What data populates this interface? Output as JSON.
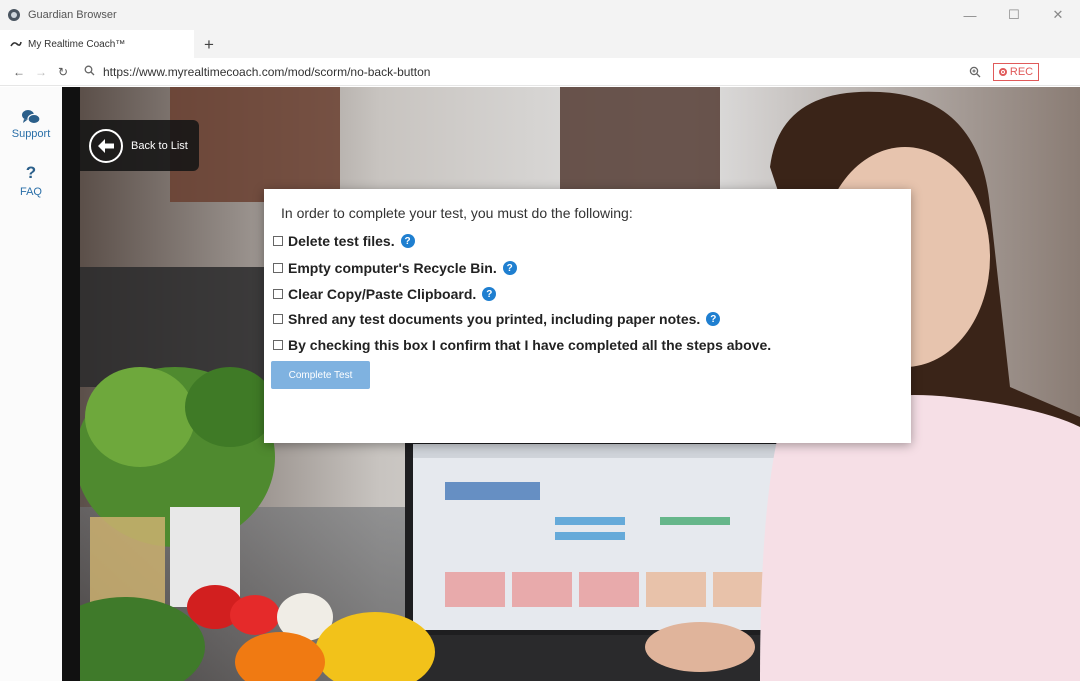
{
  "window": {
    "title": "Guardian Browser"
  },
  "tab": {
    "label": "My Realtime Coach™"
  },
  "address": {
    "url": "https://www.myrealtimecoach.com/mod/scorm/no-back-button"
  },
  "toolbar": {
    "rec_label": "REC"
  },
  "sidebar": {
    "support_label": "Support",
    "faq_glyph": "?",
    "faq_label": "FAQ"
  },
  "back": {
    "label": "Back to List"
  },
  "dialog": {
    "intro": "In order to complete your test, you must do the following:",
    "items": [
      {
        "label": "Delete test files.",
        "help": true
      },
      {
        "label": "Empty computer's Recycle Bin.",
        "help": true
      },
      {
        "label": "Clear Copy/Paste Clipboard.",
        "help": true
      },
      {
        "label": "Shred any test documents you printed, including paper notes.",
        "help": true
      },
      {
        "label": "By checking this box I confirm that I have completed all the steps above.",
        "help": false
      }
    ],
    "help_glyph": "?",
    "button_label": "Complete Test"
  },
  "colors": {
    "accent": "#1f7fd0",
    "button": "#7fb2e0",
    "rec": "#e05a5a",
    "sidebar_text": "#2a6fa8"
  },
  "icons": {
    "app": "shield-icon",
    "support": "chat-bubbles-icon",
    "faq": "question-icon",
    "back": "arrow-left-circle-icon",
    "help": "question-circle-icon",
    "zoom": "zoom-icon"
  }
}
